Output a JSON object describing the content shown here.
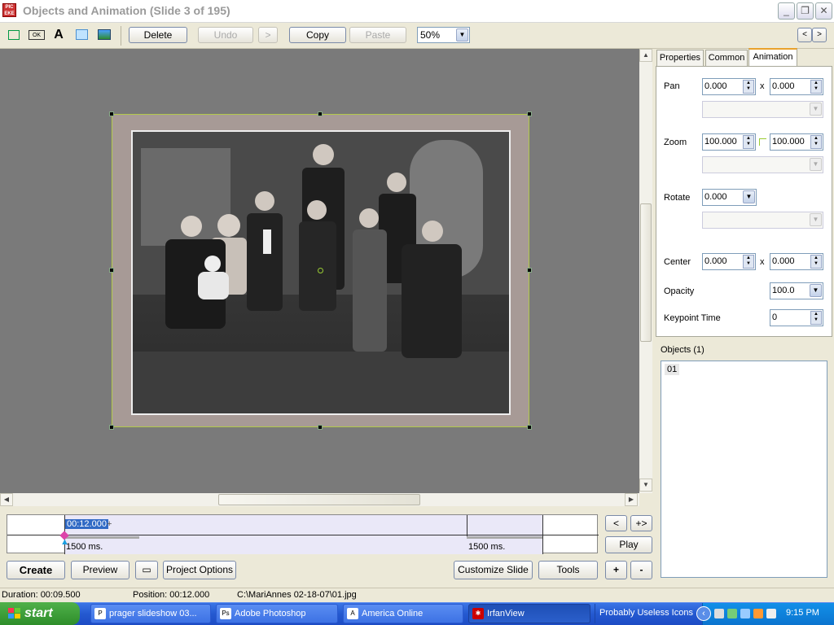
{
  "window": {
    "title": "Objects and Animation  (Slide 3 of 195)",
    "app_icon_text": "PIC EKE"
  },
  "toolbar": {
    "delete": "Delete",
    "undo": "Undo",
    "redo": ">",
    "copy": "Copy",
    "paste": "Paste",
    "zoom": "50%",
    "nav_prev": "<",
    "nav_next": ">"
  },
  "tools": {
    "rect": "rectangle-tool-icon",
    "button": "OK",
    "text": "A",
    "fill": "fill-tool-icon",
    "image": "image-tool-icon"
  },
  "tabs": [
    "Properties",
    "Common",
    "Animation"
  ],
  "animation": {
    "pan_label": "Pan",
    "pan_x": "0.000",
    "pan_y": "0.000",
    "x_sep": "x",
    "zoom_label": "Zoom",
    "zoom_x": "100.000",
    "zoom_y": "100.000",
    "rotate_label": "Rotate",
    "rotate": "0.000",
    "center_label": "Center",
    "center_x": "0.000",
    "center_y": "0.000",
    "opacity_label": "Opacity",
    "opacity": "100.0",
    "keypoint_label": "Keypoint Time",
    "keypoint": "0"
  },
  "objects": {
    "label": "Objects (1)",
    "items": [
      "01"
    ]
  },
  "timeline": {
    "time": "00:12.000",
    "plus": "+",
    "left_ms": "1500 ms.",
    "right_ms": "1500 ms.",
    "btn_prev": "<",
    "btn_add": "+>",
    "btn_play": "Play",
    "btn_plus": "+",
    "btn_minus": "-"
  },
  "bottom_buttons": {
    "create": "Create",
    "preview": "Preview",
    "project_options": "Project Options",
    "customize_slide": "Customize Slide",
    "tools": "Tools"
  },
  "status": {
    "duration": "Duration:  00:09.500",
    "position": "Position:  00:12.000",
    "file": "C:\\MariAnnes 02-18-07\\01.jpg"
  },
  "taskbar": {
    "start": "start",
    "tasks": [
      "prager slideshow 03...",
      "Adobe Photoshop",
      "America  Online",
      "IrfanView",
      "Probably Useless Icons"
    ],
    "clock": "9:15 PM"
  }
}
